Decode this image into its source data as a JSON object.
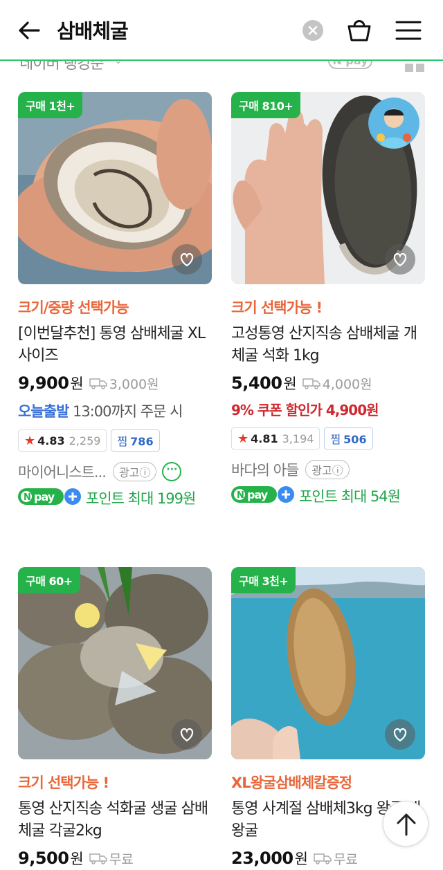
{
  "header": {
    "search_query": "삼배체굴"
  },
  "sortbar": {
    "sort_label": "네이버 랭킹순",
    "npay_label": "N pay"
  },
  "products": [
    {
      "badge": "구매 1천+",
      "option": "크기/중량 선택가능",
      "title": "[이번달추천] 통영 삼배체굴 XL사이즈",
      "price": "9,900",
      "won": "원",
      "shipping": "3,000원",
      "dispatch_highlight": "오늘출발",
      "dispatch_rest": " 13:00까지 주문 시",
      "rating": "4.83",
      "reviews": "2,259",
      "zzim_label": "찜",
      "zzim_count": "786",
      "seller": "마이어니스트...",
      "ad_label": "광고ⓘ",
      "points": "포인트 최대 199원"
    },
    {
      "badge": "구매 810+",
      "option": "크기 선택가능 !",
      "title": "고성통영 산지직송 삼배체굴 개체굴 석화 1kg",
      "price": "5,400",
      "won": "원",
      "shipping": "4,000원",
      "coupon": "9% 쿠폰 할인가 4,900원",
      "rating": "4.81",
      "reviews": "3,194",
      "zzim_label": "찜",
      "zzim_count": "506",
      "seller": "바다의 아들",
      "ad_label": "광고ⓘ",
      "points": "포인트 최대 54원"
    },
    {
      "badge": "구매 60+",
      "option": "크기 선택가능 !",
      "title": "통영 산지직송 석화굴 생굴 삼배체굴 각굴2kg",
      "price": "9,500",
      "won": "원",
      "shipping": "무료"
    },
    {
      "badge": "구매 3천+",
      "option": "XL왕굴삼배체칼증정",
      "title": "통영 사계절 삼배체3kg 왕굴 대왕굴",
      "price": "23,000",
      "won": "원",
      "shipping": "무료"
    }
  ],
  "icons": {
    "back": "arrow-left-icon",
    "clear": "close-icon",
    "cart": "shopping-bag-icon",
    "menu": "hamburger-menu-icon",
    "zzim": "heart-icon",
    "scroll_top": "arrow-up-icon"
  },
  "colors": {
    "brand_green": "#25b24a",
    "option_orange": "#e8663a",
    "coupon_red": "#d0282e",
    "dispatch_blue": "#3a70d8"
  }
}
